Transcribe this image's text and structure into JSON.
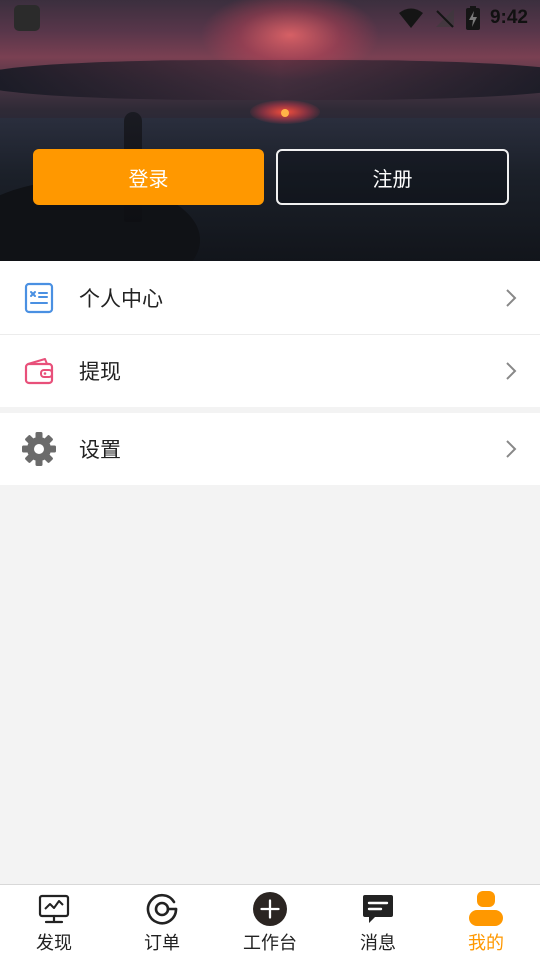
{
  "status_bar": {
    "time": "9:42",
    "icons": [
      "app-badge-icon",
      "wifi-icon",
      "no-signal-icon",
      "battery-charging-icon"
    ]
  },
  "auth": {
    "login_label": "登录",
    "register_label": "注册"
  },
  "menu": {
    "items": [
      {
        "label": "个人中心",
        "icon": "profile-card-icon",
        "color": "#4a90e2"
      },
      {
        "label": "提现",
        "icon": "wallet-icon",
        "color": "#e8507a"
      },
      {
        "label": "设置",
        "icon": "gear-icon",
        "color": "#6b6b6b"
      }
    ]
  },
  "tabbar": {
    "active_color": "#ff9800",
    "items": [
      {
        "label": "发现",
        "icon": "monitor-chart-icon"
      },
      {
        "label": "订单",
        "icon": "target-icon"
      },
      {
        "label": "工作台",
        "icon": "plus-circle-icon"
      },
      {
        "label": "消息",
        "icon": "chat-icon"
      },
      {
        "label": "我的",
        "icon": "person-icon",
        "active": true
      }
    ]
  },
  "colors": {
    "accent": "#ff9800",
    "page_background": "#f3f3f3"
  }
}
